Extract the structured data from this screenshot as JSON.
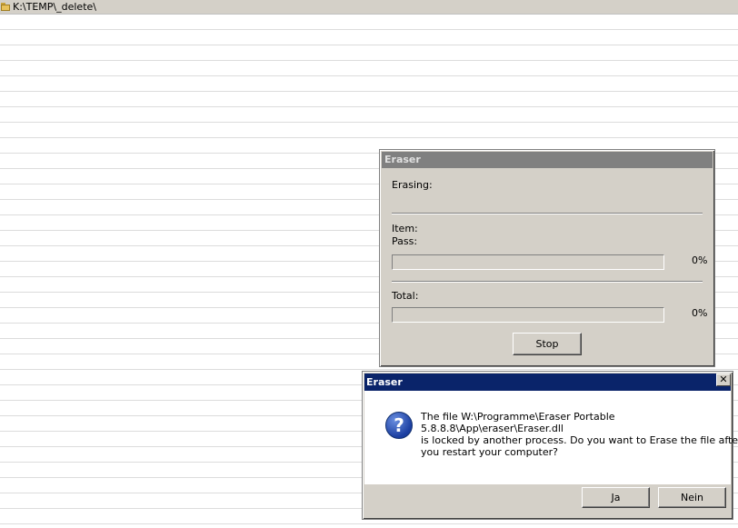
{
  "explorer": {
    "path": "K:\\TEMP\\_delete\\",
    "folder_icon": "folder-icon"
  },
  "progress_dialog": {
    "title": "Eraser",
    "erasing_label": "Erasing:",
    "item_label": "Item:",
    "pass_label": "Pass:",
    "pass_percent_text": "0%",
    "pass_progress": 0,
    "total_label": "Total:",
    "total_percent_text": "0%",
    "total_progress": 0,
    "stop_button": "Stop"
  },
  "message_box": {
    "title": "Eraser",
    "close_symbol": "✕",
    "icon": "question-icon",
    "icon_glyph": "?",
    "lines": [
      "The file W:\\Programme\\Eraser Portable",
      "5.8.8.8\\App\\eraser\\Eraser.dll",
      "is locked by another process. Do you want to Erase the file after",
      "you restart your computer?"
    ],
    "yes_button": "Ja",
    "no_button": "Nein"
  },
  "colors": {
    "dialog_face": "#d4d0c8",
    "active_title": "#0a246a",
    "inactive_title": "#808080"
  }
}
